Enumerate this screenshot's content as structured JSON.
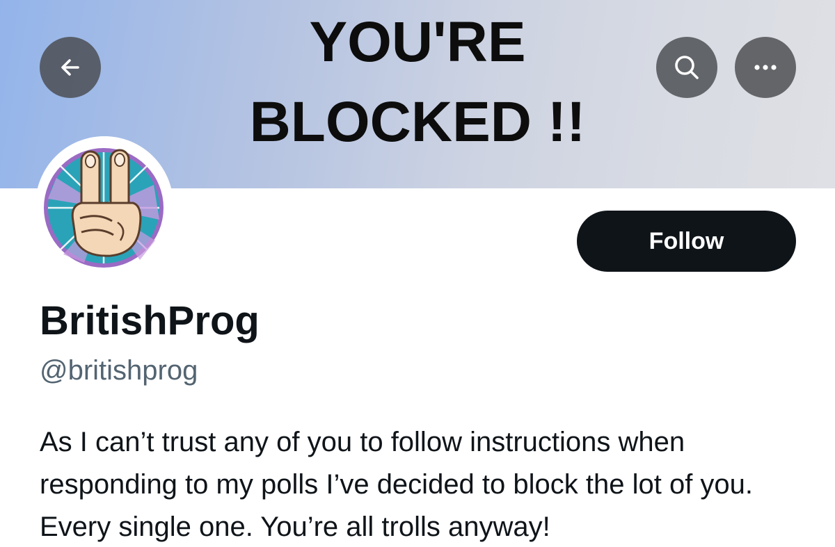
{
  "banner": {
    "line1": "YOU'RE",
    "line2": "BLOCKED !!"
  },
  "header": {
    "back_icon": "arrow-left-icon",
    "search_icon": "search-icon",
    "more_icon": "more-dots-icon"
  },
  "profile": {
    "avatar": "peace-sign-hand-avatar",
    "follow_label": "Follow",
    "display_name": "BritishProg",
    "handle": "@britishprog",
    "bio": "As I can’t trust any of you to follow instructions when responding to my polls I’ve decided to block the lot of you. Every single one. You’re all trolls anyway!"
  },
  "colors": {
    "follow_bg": "#0f1419",
    "handle": "#536471",
    "text": "#0f1419",
    "avatar_teal": "#2aa3b8",
    "avatar_purple": "#9a6bc4"
  }
}
